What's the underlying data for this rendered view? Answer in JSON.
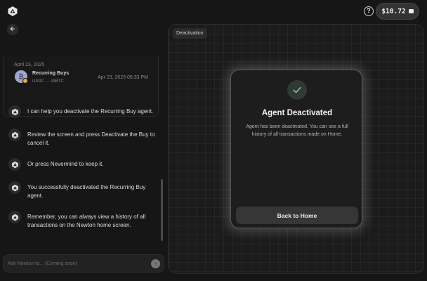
{
  "header": {
    "logo_icon": "newton-logo-icon",
    "help_icon": "help-circle-icon",
    "help_glyph": "?",
    "balance": "$10.72",
    "wallet_icon": "wallet-icon"
  },
  "sidebar": {
    "back_icon": "arrow-left-icon",
    "transaction": {
      "date": "April 23, 2025",
      "name": "Recurring Buys",
      "pair": "USDC → cbBTC",
      "timestamp": "Apr 23, 2025 05:33 PM",
      "coin_glyph": "₿",
      "coin_icon": "bitcoin-icon"
    },
    "messages": [
      {
        "text": "I can help you deactivate the Recurring Buy agent."
      },
      {
        "text": "Review the screen and press Deactivate the Buy to cancel it."
      },
      {
        "text": "Or press Nevermind to keep it."
      },
      {
        "text": "You successfully deactivated the Recurring Buy agent."
      },
      {
        "text": "Remember, you can always view a history of all transactions on the Newton home screen."
      }
    ],
    "input": {
      "placeholder": "Ask Newton to... (Coming soon)",
      "value": ""
    },
    "send_glyph": "↑"
  },
  "panel": {
    "tag": "Deactivation",
    "modal": {
      "icon": "check-icon",
      "title": "Agent Deactivated",
      "body": "Agent has been deactivated. You can see a full history of all transactions made on Home.",
      "button_label": "Back to Home"
    }
  },
  "colors": {
    "background": "#161616",
    "panel": "#1b1b1b",
    "accent_check": "#8fc9a8"
  }
}
